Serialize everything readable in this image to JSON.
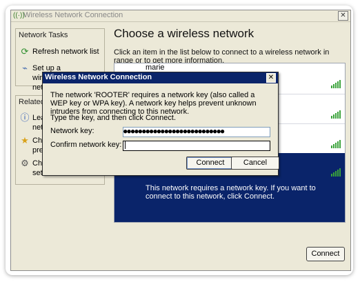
{
  "window": {
    "title": "Wireless Network Connection",
    "close_label": "✕"
  },
  "sidebar": {
    "network_tasks": {
      "header": "Network Tasks",
      "items": [
        {
          "label": "Refresh network list",
          "icon": "refresh-icon"
        },
        {
          "label": "Set up a wireless network for a",
          "icon": "wireless-setup-icon"
        }
      ]
    },
    "related_tasks": {
      "header": "Related T",
      "items": [
        {
          "label": "Lear netw",
          "icon": "info-icon"
        },
        {
          "label": "Cha pref",
          "icon": "star-icon"
        },
        {
          "label": "Cha setti",
          "icon": "settings-icon"
        }
      ]
    }
  },
  "main": {
    "heading": "Choose a wireless network",
    "instructions": "Click an item in the list below to connect to a wireless network in range or to get more information.",
    "networks": [
      {
        "name": "marie",
        "signal_bars": 5
      },
      {
        "name": "",
        "signal_bars": 5
      },
      {
        "name": "",
        "signal_bars": 5
      },
      {
        "name": "",
        "signal_bars": 5,
        "selected": true,
        "description": "This network requires a network key. If you want to connect to this network, click Connect."
      }
    ],
    "connect_label": "Connect"
  },
  "dialog": {
    "title": "Wireless Network Connection",
    "close_label": "✕",
    "message": "The network 'ROOTER' requires a network key (also called a WEP key or WPA key). A network key helps prevent unknown intruders from connecting to this network.",
    "prompt": "Type the key, and then click Connect.",
    "network_key_label": "Network key:",
    "network_key_value": "●●●●●●●●●●●●●●●●●●●●●●●●●●●",
    "confirm_key_label": "Confirm network key:",
    "confirm_key_value": "",
    "connect_label": "Connect",
    "cancel_label": "Cancel"
  },
  "colors": {
    "title_active": "#0a246a",
    "selection": "#0a246a",
    "signal": "#3aa33a",
    "window_bg": "#ece9d8"
  }
}
